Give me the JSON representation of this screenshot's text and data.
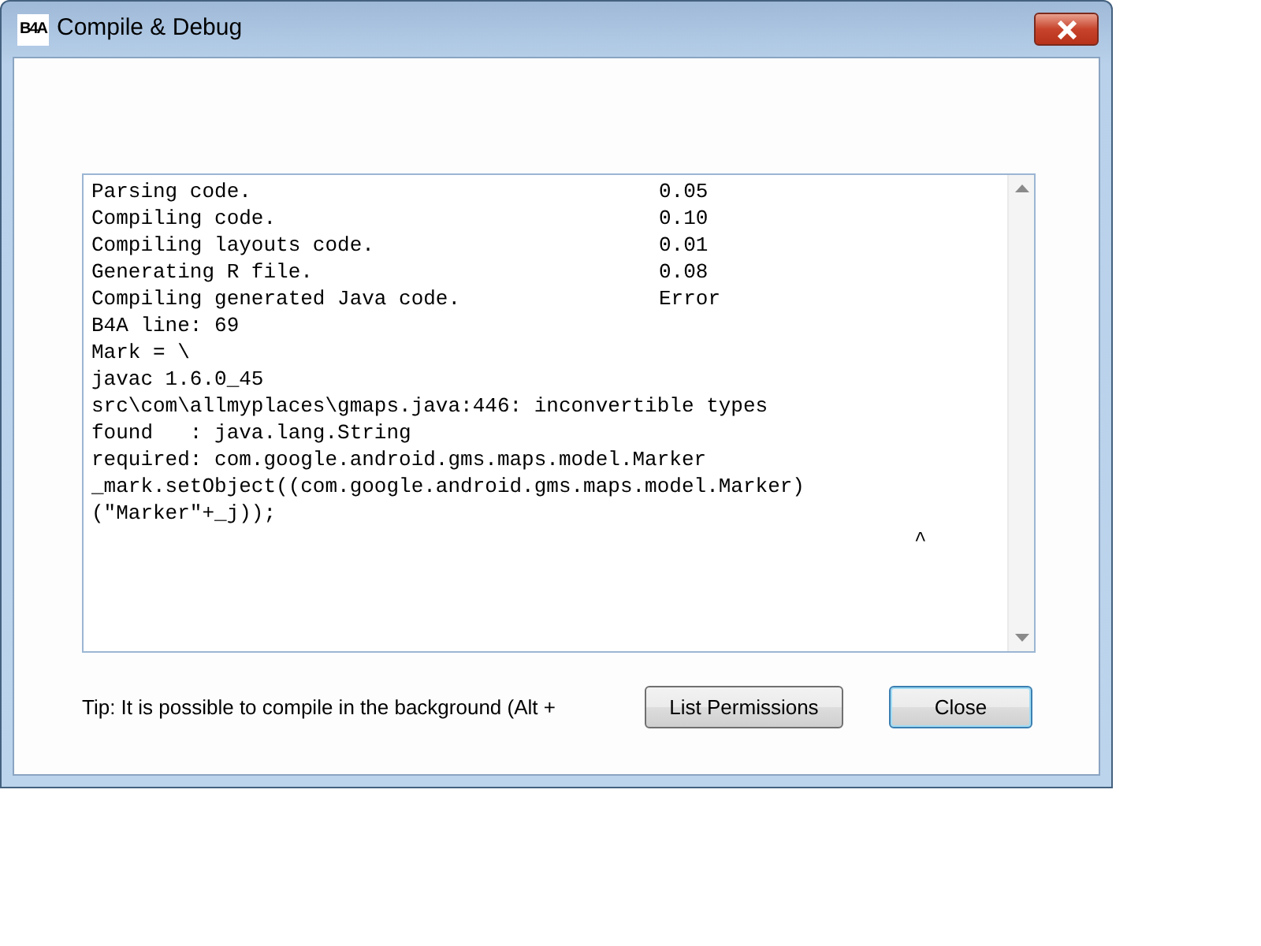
{
  "window": {
    "title": "Compile & Debug",
    "icon_text": "B4A"
  },
  "steps": [
    {
      "label": "Parsing code.",
      "result": "0.05"
    },
    {
      "label": "Compiling code.",
      "result": "0.10"
    },
    {
      "label": "Compiling layouts code.",
      "result": "0.01"
    },
    {
      "label": "Generating R file.",
      "result": "0.08"
    },
    {
      "label": "Compiling generated Java code.",
      "result": "Error"
    }
  ],
  "output_lines": [
    {
      "kind": "text",
      "text": "B4A line: 69"
    },
    {
      "kind": "text",
      "text": "Mark = \\"
    },
    {
      "kind": "text",
      "text": "javac 1.6.0_45"
    },
    {
      "kind": "text",
      "text": "src\\com\\allmyplaces\\gmaps.java:446: inconvertible types"
    },
    {
      "kind": "text",
      "text": "found   : java.lang.String"
    },
    {
      "kind": "text",
      "text": "required: com.google.android.gms.maps.model.Marker"
    },
    {
      "kind": "text",
      "text": "_mark.setObject((com.google.android.gms.maps.model.Marker)"
    },
    {
      "kind": "text",
      "text": "(\"Marker\"+_j));"
    },
    {
      "kind": "caret",
      "text": "^"
    }
  ],
  "tip": "Tip: It is possible to compile in the background (Alt +",
  "buttons": [
    {
      "label": "List Permissions",
      "default": false
    },
    {
      "label": "Close",
      "default": true
    }
  ]
}
